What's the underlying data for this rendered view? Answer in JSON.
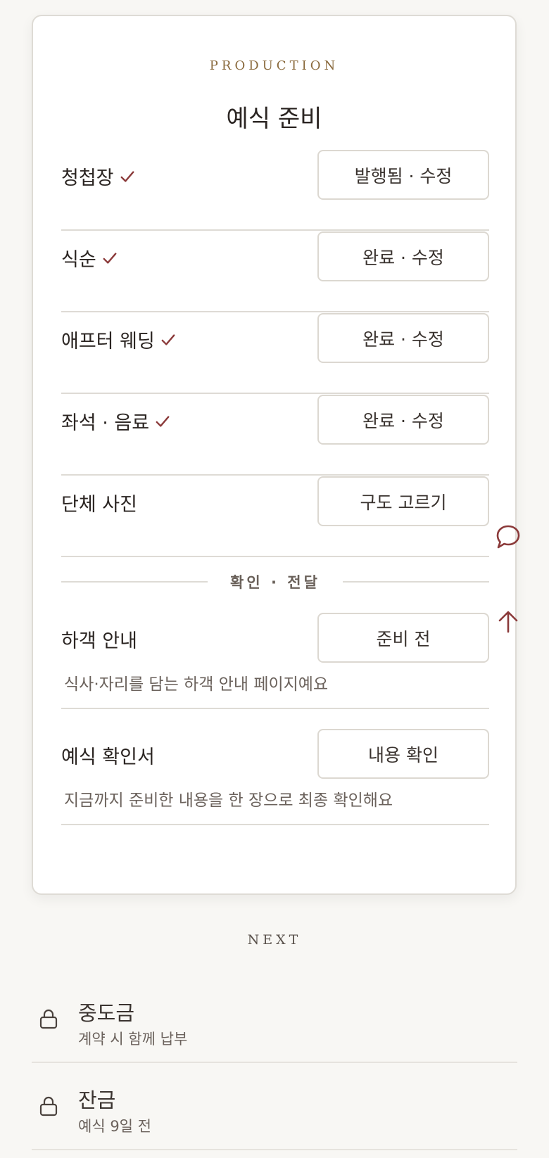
{
  "production": {
    "eyebrow": "PRODUCTION",
    "title": "예식 준비",
    "items": [
      {
        "label": "청첩장",
        "checked": true,
        "button": "발행됨 · 수정"
      },
      {
        "label": "식순",
        "checked": true,
        "button": "완료 · 수정"
      },
      {
        "label": "애프터 웨딩",
        "checked": true,
        "button": "완료 · 수정"
      },
      {
        "label": "좌석 · 음료",
        "checked": true,
        "button": "완료 · 수정"
      },
      {
        "label": "단체 사진",
        "checked": false,
        "button": "구도 고르기"
      }
    ],
    "section_label": "확인 · 전달",
    "confirm_items": [
      {
        "label": "하객 안내",
        "button": "준비 전",
        "desc": "식사·자리를 담는 하객 안내 페이지예요"
      },
      {
        "label": "예식 확인서",
        "button": "내용 확인",
        "desc": "지금까지 준비한 내용을 한 장으로 최종 확인해요"
      }
    ]
  },
  "side_actions": {
    "chat_icon": "chat-bubble-icon",
    "top_icon": "arrow-up-icon"
  },
  "next": {
    "label": "NEXT",
    "items": [
      {
        "title": "중도금",
        "sub": "계약 시 함께 납부",
        "icon": "lock-icon"
      },
      {
        "title": "잔금",
        "sub": "예식 9일 전",
        "icon": "lock-icon"
      }
    ]
  },
  "colors": {
    "accent": "#8b3a3a",
    "eyebrow": "#8a6a3d",
    "background": "#f8f7f4"
  }
}
